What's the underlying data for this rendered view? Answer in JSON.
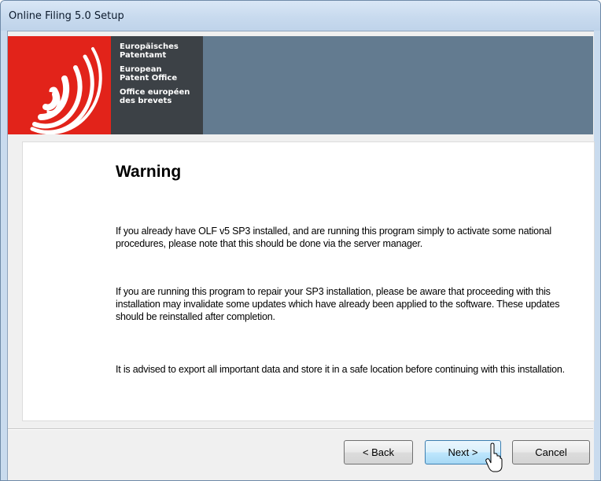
{
  "window": {
    "title": "Online Filing 5.0 Setup"
  },
  "banner": {
    "logo_lines": [
      [
        "Europäisches",
        "Patentamt"
      ],
      [
        "European",
        "Patent Office"
      ],
      [
        "Office européen",
        "des brevets"
      ]
    ],
    "colors": {
      "logo_red": "#e2231a",
      "logo_dark": "#3c4146",
      "banner_blue": "#637b90"
    }
  },
  "content": {
    "heading": "Warning",
    "paragraphs": [
      "If you already have OLF v5 SP3 installed, and are running this program simply to activate some national procedures, please note that this should be done via the server manager.",
      "If you are running this program to repair your SP3 installation, please be aware that proceeding with this installation may invalidate some updates which have already been applied to the software. These updates should be reinstalled after completion.",
      "It is advised to export all important data and store it in a safe location before continuing with this installation."
    ]
  },
  "buttons": {
    "back": "< Back",
    "next": "Next >",
    "cancel": "Cancel"
  }
}
